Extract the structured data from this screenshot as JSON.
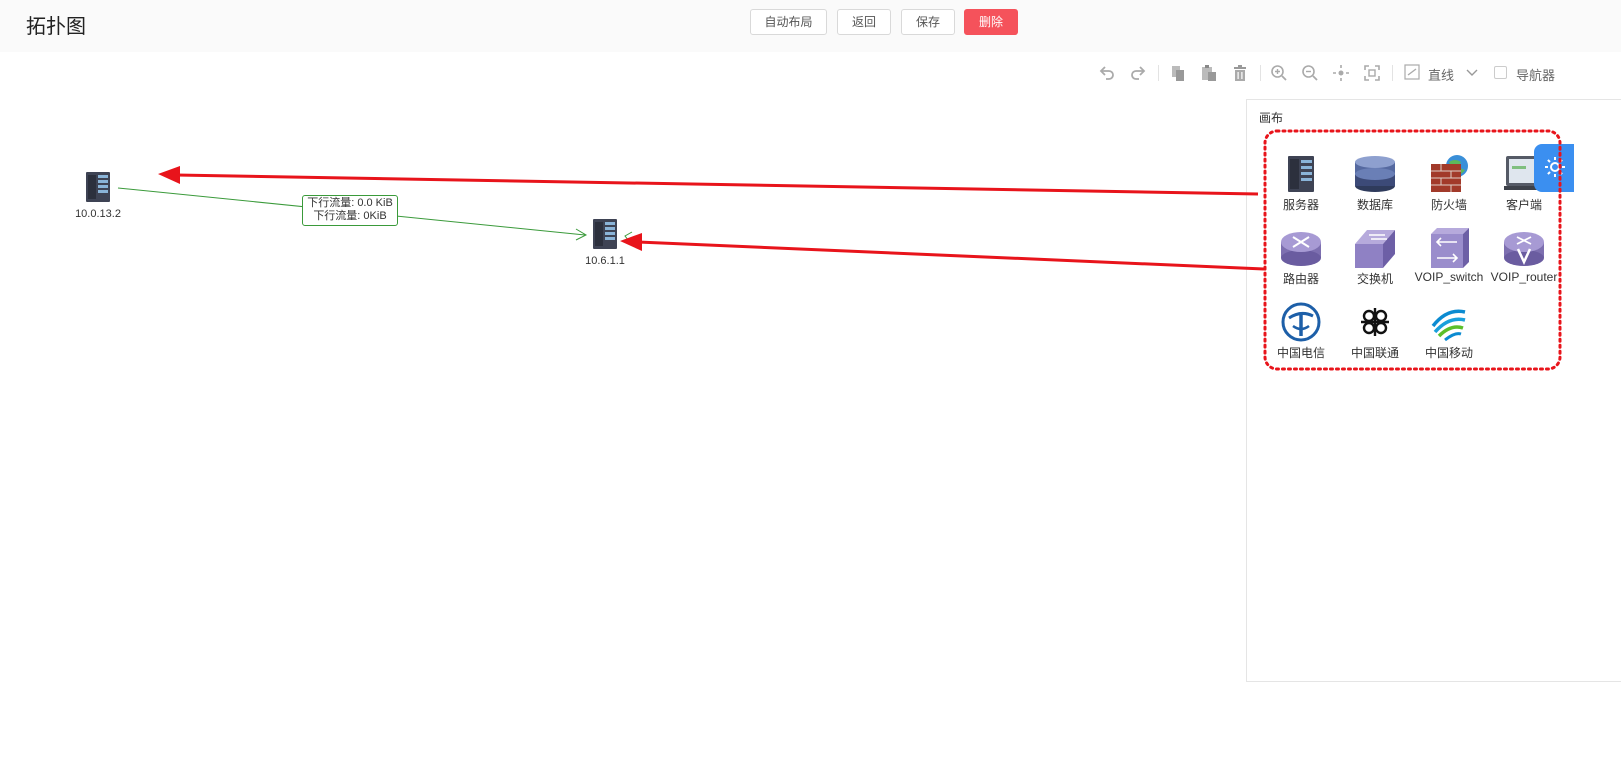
{
  "header": {
    "title": "拓扑图",
    "buttons": {
      "auto_layout": "自动布局",
      "back": "返回",
      "save": "保存",
      "delete": "删除"
    }
  },
  "toolbar": {
    "icons": [
      "undo-icon",
      "redo-icon",
      "copy-icon",
      "paste-icon",
      "delete-icon",
      "zoom-in-icon",
      "zoom-out-icon",
      "fit-icon",
      "actual-size-icon"
    ],
    "line_type": "直线",
    "navigator_label": "导航器",
    "navigator_checked": false
  },
  "canvas": {
    "nodes": [
      {
        "id": "n1",
        "label": "10.0.13.2",
        "icon": "server-icon"
      },
      {
        "id": "n2",
        "label": "10.6.1.1",
        "icon": "server-icon"
      }
    ],
    "edge": {
      "label_line1": "下行流量: 0.0 KiB",
      "label_line2": "下行流量: 0KiB",
      "color": "#3a9a3a"
    }
  },
  "panel": {
    "title": "画布",
    "items": [
      {
        "label": "服务器",
        "icon": "server-icon"
      },
      {
        "label": "数据库",
        "icon": "database-icon"
      },
      {
        "label": "防火墙",
        "icon": "firewall-icon"
      },
      {
        "label": "客户端",
        "icon": "client-icon"
      },
      {
        "label": "路由器",
        "icon": "router-icon"
      },
      {
        "label": "交换机",
        "icon": "switch-icon"
      },
      {
        "label": "VOIP_switch",
        "icon": "voip-switch-icon"
      },
      {
        "label": "VOIP_router",
        "icon": "voip-router-icon"
      },
      {
        "label": "中国电信",
        "icon": "china-telecom-icon"
      },
      {
        "label": "中国联通",
        "icon": "china-unicom-icon"
      },
      {
        "label": "中国移动",
        "icon": "china-mobile-icon"
      }
    ]
  },
  "colors": {
    "danger": "#f5525b",
    "accent": "#3b8ff0",
    "annotation": "#e8141b",
    "edge": "#3a9a3a"
  }
}
